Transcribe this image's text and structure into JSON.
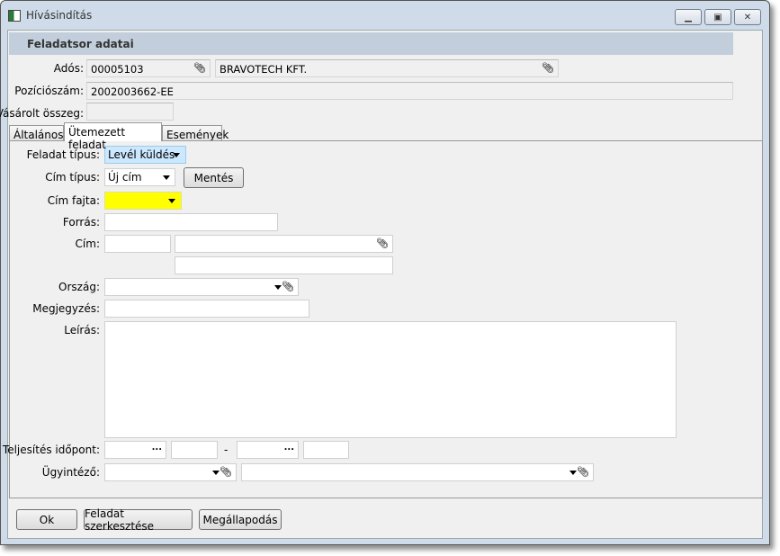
{
  "window": {
    "title": "Hívásindítás",
    "controls": [
      "minimize",
      "maximize",
      "close"
    ]
  },
  "header": {
    "title": "Feladatsor adatai"
  },
  "top": {
    "ados_label": "Adós:",
    "ados_code": "00005103",
    "ados_name": "BRAVOTECH KFT.",
    "pozicio_label": "Pozíciószám:",
    "pozicio_value": "2002003662-EE",
    "vasarolt_label": "Vásárolt összeg:",
    "vasarolt_value": ""
  },
  "tabs": [
    {
      "label": "Általános"
    },
    {
      "label": "Ütemezett feladat",
      "active": true
    },
    {
      "label": "Események"
    }
  ],
  "form": {
    "feladat_tipus_label": "Feladat típus:",
    "feladat_tipus_value": "Levél küldés",
    "cim_tipus_label": "Cím típus:",
    "cim_tipus_value": "Új cím",
    "mentes_label": "Mentés",
    "cim_fajta_label": "Cím fajta:",
    "cim_fajta_value": "",
    "forras_label": "Forrás:",
    "cim_label": "Cím:",
    "orszag_label": "Ország:",
    "megjegyzes_label": "Megjegyzés:",
    "leiras_label": "Leírás:",
    "teljesites_label": "Teljesítés időpont:",
    "dash": "-",
    "ugyintezo_label": "Ügyintéző:",
    "dots": "..."
  },
  "buttons": {
    "ok": "Ok",
    "edit": "Feladat szerkesztése",
    "agreement": "Megállapodás"
  },
  "colors": {
    "header_band": "#c2cedb",
    "combo_focus": "#cce8ff",
    "required": "#ffff00"
  },
  "icons": {
    "attach": "paperclip-icon",
    "dropdown": "caret-down-icon"
  }
}
